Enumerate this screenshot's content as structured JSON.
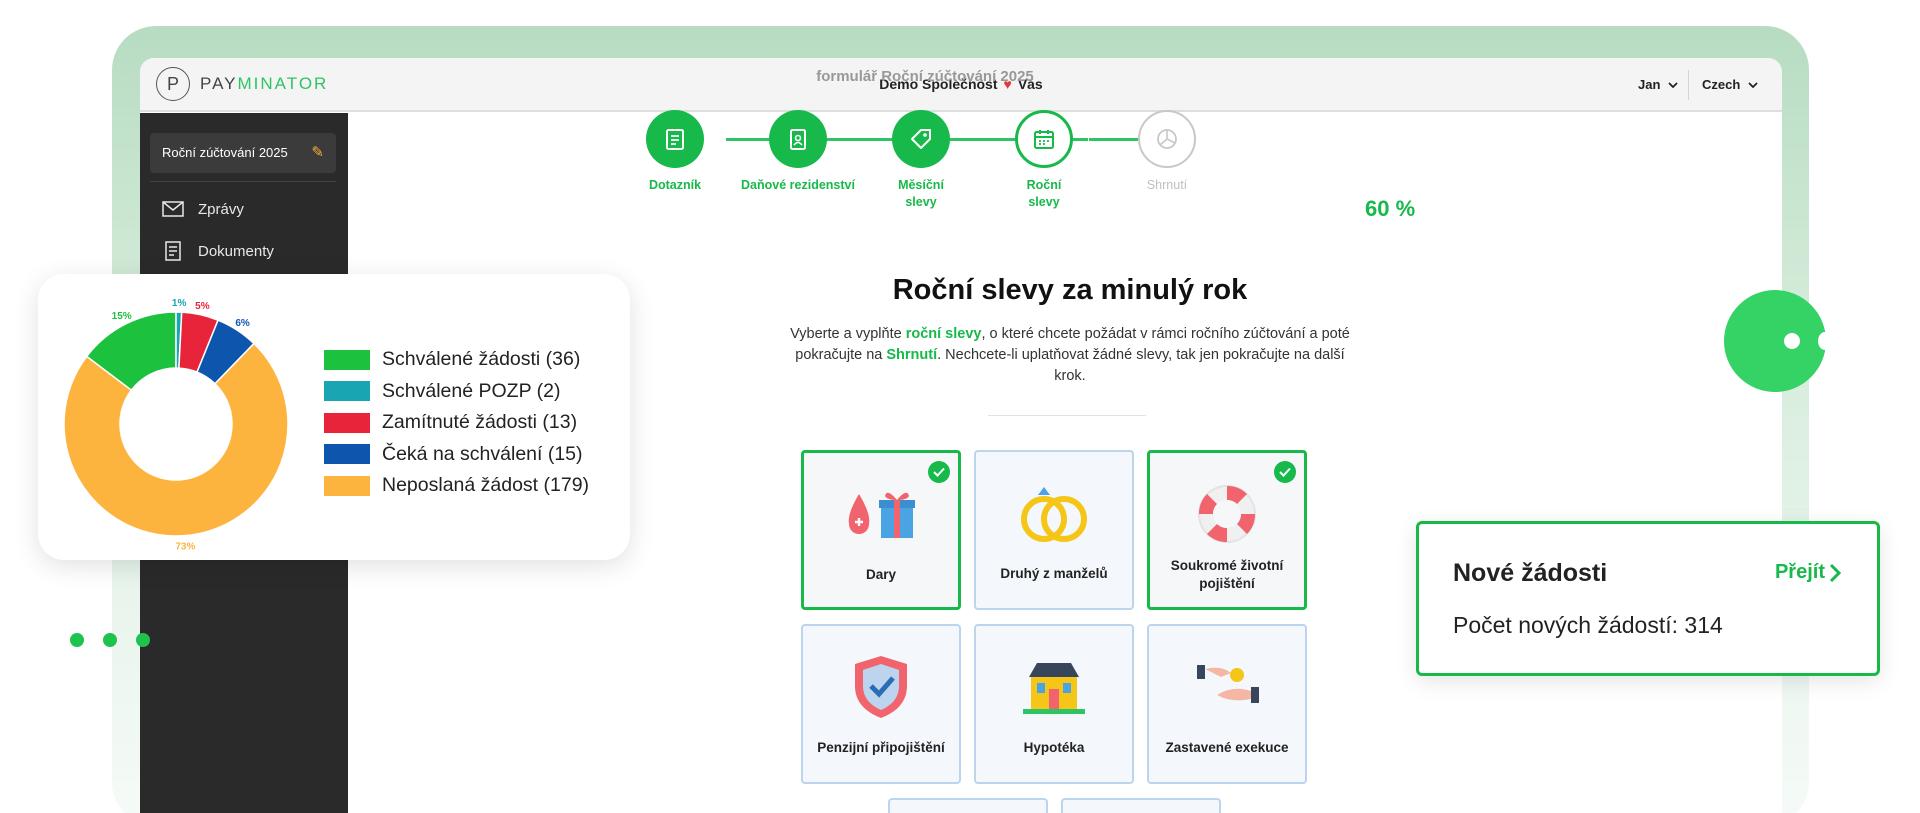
{
  "app": {
    "logo_letter": "P",
    "logo_text_a": "PAY",
    "logo_text_b": "MINATOR",
    "company": "Demo Společnost",
    "company_suffix": "Vás",
    "user": "Jan",
    "language": "Czech",
    "brand_green": "#17b94a"
  },
  "sidebar": {
    "current_form": "Roční zúčtování 2025",
    "items": [
      {
        "label": "Zprávy",
        "icon": "envelope-icon"
      },
      {
        "label": "Dokumenty",
        "icon": "document-icon"
      }
    ]
  },
  "form": {
    "label": "formulář Roční zúčtování 2025",
    "steps": [
      {
        "label": "Dotazník",
        "state": "done",
        "icon": "clipboard-icon"
      },
      {
        "label": "Daňové rezidenství",
        "state": "done",
        "icon": "badge-icon"
      },
      {
        "label": "Měsíční slevy",
        "state": "done",
        "icon": "tag-icon"
      },
      {
        "label": "Roční slevy",
        "state": "current",
        "icon": "calendar-icon"
      },
      {
        "label": "Shrnutí",
        "state": "todo",
        "icon": "chart-icon"
      }
    ],
    "progress": "60 %",
    "heading": "Roční slevy za minulý rok",
    "intro_1": "Vyberte a vyplňte ",
    "intro_link_1": "roční slevy",
    "intro_2": ", o které chcete požádat v rámci ročního zúčtování a poté pokračujte na ",
    "intro_link_2": "Shrnutí",
    "intro_3": ". Nechcete-li uplatňovat žádné slevy, tak jen pokračujte na další krok.",
    "tiles": [
      {
        "label": "Dary",
        "selected": true
      },
      {
        "label": "Druhý z manželů",
        "selected": false
      },
      {
        "label": "Soukromé životní pojištění",
        "selected": true
      },
      {
        "label": "Penzijní připojištění",
        "selected": false
      },
      {
        "label": "Hypotéka",
        "selected": false
      },
      {
        "label": "Zastavené exekuce",
        "selected": false
      }
    ]
  },
  "chart_data": {
    "type": "pie",
    "donut": true,
    "categories": [
      "Schválené žádosti (36)",
      "Schválené POZP (2)",
      "Zamítnuté žádosti (13)",
      "Čeká na schválení (15)",
      "Neposlaná žádost (179)"
    ],
    "values": [
      36,
      2,
      13,
      15,
      179
    ],
    "data_labels": [
      "15%",
      "1%",
      "5%",
      "6%",
      "73%"
    ],
    "colors": [
      "#1cc23e",
      "#1aa5b3",
      "#e8243a",
      "#0e55ad",
      "#fdb43e"
    ],
    "legend_position": "right"
  },
  "requests": {
    "title": "Nové žádosti",
    "link": "Přejít",
    "count_text": "Počet nových žádostí: 314"
  }
}
